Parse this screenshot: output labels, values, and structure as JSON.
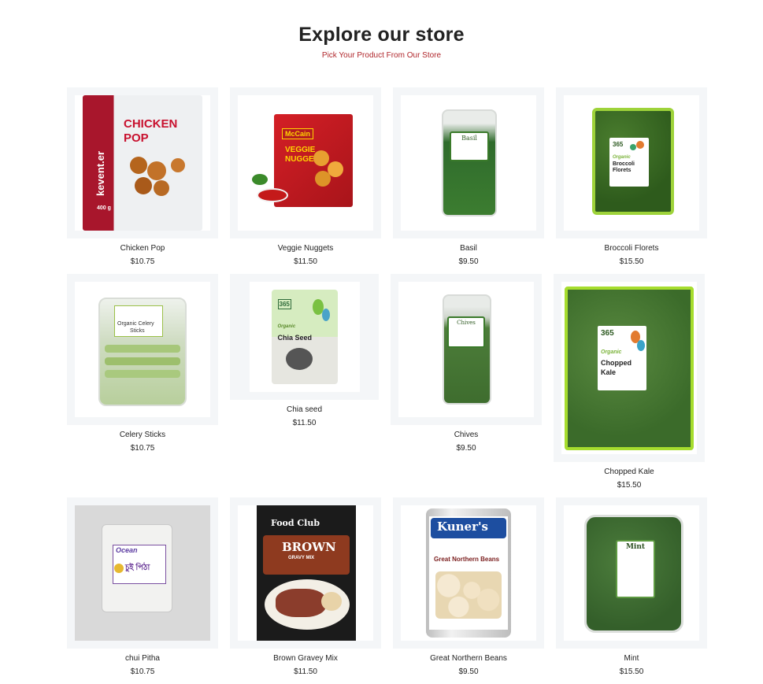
{
  "header": {
    "title": "Explore our store",
    "subtitle": "Pick Your Product From Our Store"
  },
  "products": [
    {
      "name": "Chicken Pop",
      "price": "$10.75",
      "art": "chicken-pop",
      "pack_text": [
        "CHICKEN",
        "POP",
        "kevent.er",
        "400 g"
      ]
    },
    {
      "name": "Veggie Nuggets",
      "price": "$11.50",
      "art": "veggie-nuggets",
      "pack_text": [
        "McCain",
        "VEGGIE",
        "NUGGETS"
      ]
    },
    {
      "name": "Basil",
      "price": "$9.50",
      "art": "basil",
      "pack_text": [
        "Basil"
      ]
    },
    {
      "name": "Broccoli Florets",
      "price": "$15.50",
      "art": "broccoli",
      "pack_text": [
        "365",
        "Organic",
        "Broccoli",
        "Florets"
      ]
    },
    {
      "name": "Celery Sticks",
      "price": "$10.75",
      "art": "celery",
      "pack_text": [
        "Organic Celery",
        "Sticks"
      ]
    },
    {
      "name": "Chia seed",
      "price": "$11.50",
      "art": "chia",
      "pack_text": [
        "365",
        "Organic",
        "Chia Seed"
      ]
    },
    {
      "name": "Chives",
      "price": "$9.50",
      "art": "chives",
      "pack_text": [
        "Chives"
      ]
    },
    {
      "name": "Chopped Kale",
      "price": "$15.50",
      "art": "kale",
      "pack_text": [
        "365",
        "Organic",
        "Chopped",
        "Kale"
      ]
    },
    {
      "name": "chui Pitha",
      "price": "$10.75",
      "art": "chui-pitha",
      "pack_text": [
        "Ocean",
        "চুই পিঠা"
      ]
    },
    {
      "name": "Brown Gravey Mix",
      "price": "$11.50",
      "art": "gravy",
      "pack_text": [
        "Food Club",
        "BROWN",
        "GRAVY MIX"
      ]
    },
    {
      "name": "Great Northern Beans",
      "price": "$9.50",
      "art": "beans",
      "pack_text": [
        "Kuner's",
        "Great Northern Beans"
      ]
    },
    {
      "name": "Mint",
      "price": "$15.50",
      "art": "mint",
      "pack_text": [
        "Mint"
      ]
    }
  ],
  "colors": {
    "accent": "#b0262b",
    "card_bg": "#f4f6f8"
  }
}
